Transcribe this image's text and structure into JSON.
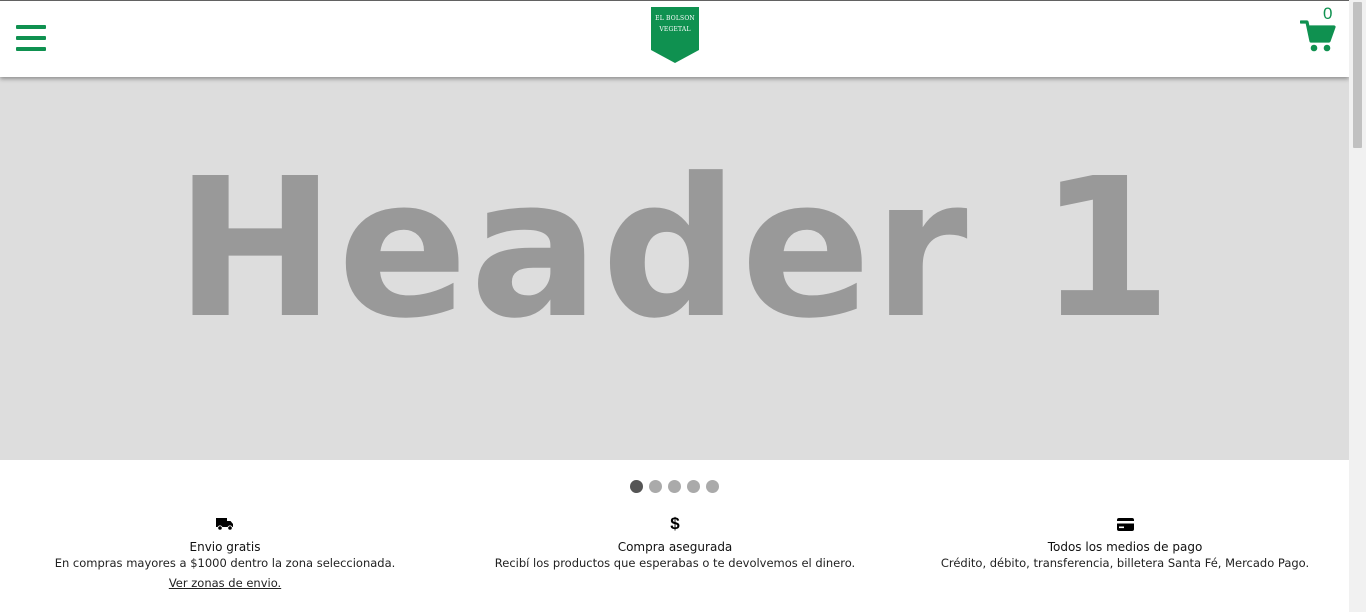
{
  "brand": {
    "logo_line1": "EL BOLSON",
    "logo_line2": "VEGETAL",
    "accent_color": "#0f9150"
  },
  "header": {
    "menu_icon": "hamburger-menu-icon",
    "cart_icon": "shopping-cart-icon",
    "cart_count": "0"
  },
  "hero": {
    "title": "Header 1",
    "slide_count": 5,
    "active_slide": 1
  },
  "features": [
    {
      "icon": "truck-icon",
      "title": "Envio gratis",
      "description": "En compras mayores a $1000 dentro la zona seleccionada.",
      "link": "Ver zonas de envio."
    },
    {
      "icon": "dollar-icon",
      "icon_text": "$",
      "title": "Compra asegurada",
      "description": "Recibí los productos que esperabas o te devolvemos el dinero."
    },
    {
      "icon": "credit-card-icon",
      "title": "Todos los medios de pago",
      "description": "Crédito, débito, transferencia, billetera Santa Fé, Mercado Pago."
    }
  ]
}
